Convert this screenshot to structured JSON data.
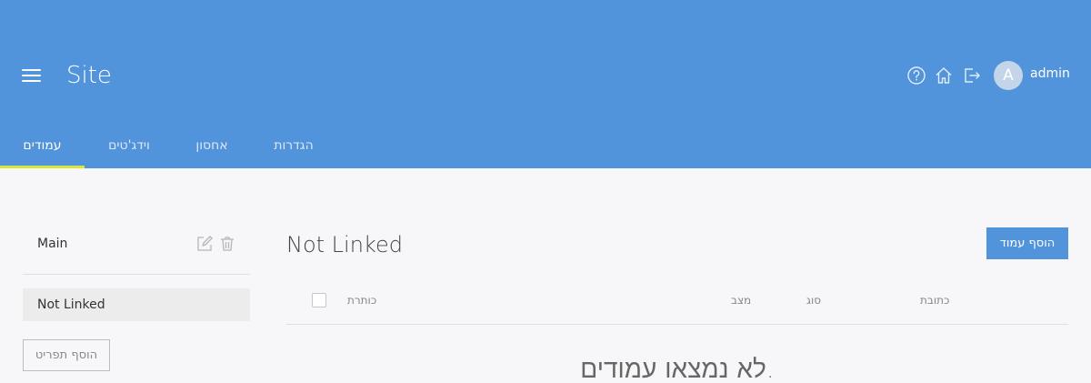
{
  "header": {
    "site_title": "Site",
    "username": "admin",
    "avatar_initial": "A",
    "background_color": "#5294db",
    "icons": [
      "help-icon",
      "home-icon",
      "logout-icon"
    ]
  },
  "tabs": [
    {
      "label": "עמודים",
      "active": true
    },
    {
      "label": "וידג'טים",
      "active": false
    },
    {
      "label": "אחסון",
      "active": false
    },
    {
      "label": "הגדרות",
      "active": false
    }
  ],
  "sidebar": {
    "items": [
      {
        "label": "Main",
        "selected": false
      },
      {
        "label": "Not Linked",
        "selected": true
      }
    ],
    "add_item_label": "הוסף תפריט"
  },
  "main": {
    "title": "Not Linked",
    "add_page_label": "הוסף עמוד",
    "columns": {
      "title": "כותרת",
      "status": "מצב",
      "type": "סוג",
      "address": "כתובת"
    },
    "empty_message": "לא נמצאו עמודים."
  }
}
